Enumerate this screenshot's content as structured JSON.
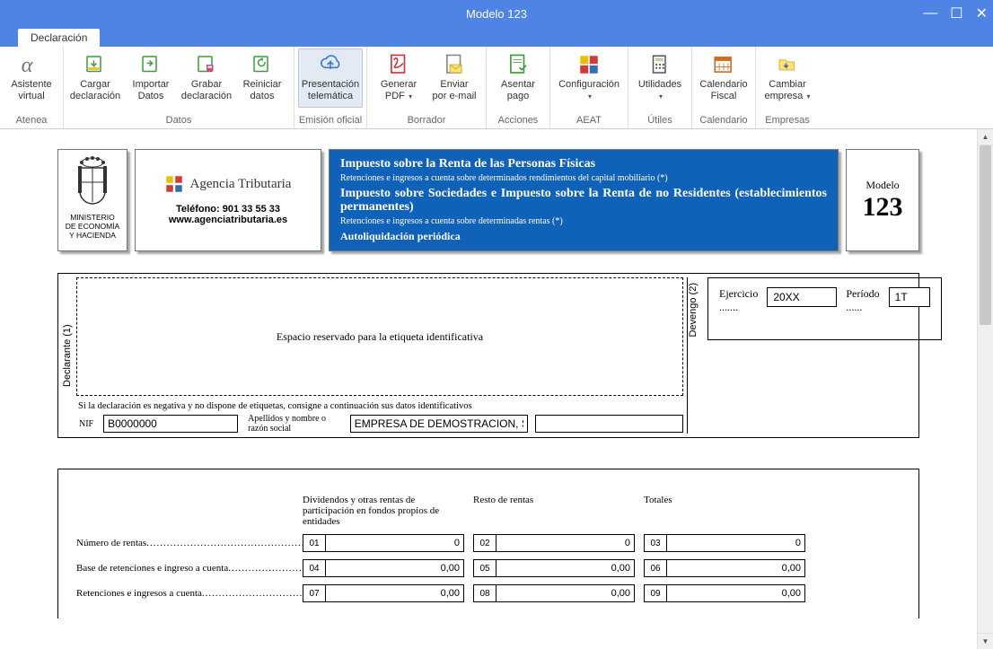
{
  "window": {
    "title": "Modelo 123"
  },
  "tabs": {
    "declaracion": "Declaración"
  },
  "ribbon": {
    "groups": {
      "atenea": {
        "label": "Atenea",
        "asistente": {
          "l1": "Asistente",
          "l2": "virtual"
        }
      },
      "datos": {
        "label": "Datos",
        "cargar": {
          "l1": "Cargar",
          "l2": "declaración"
        },
        "importar": {
          "l1": "Importar",
          "l2": "Datos"
        },
        "grabar": {
          "l1": "Grabar",
          "l2": "declaración"
        },
        "reiniciar": {
          "l1": "Reiniciar",
          "l2": "datos"
        }
      },
      "emision": {
        "label": "Emisión oficial",
        "presentacion": {
          "l1": "Presentación",
          "l2": "telemática"
        }
      },
      "borrador": {
        "label": "Borrador",
        "generar": {
          "l1": "Generar",
          "l2": "PDF"
        },
        "enviar": {
          "l1": "Enviar",
          "l2": "por e-mail"
        }
      },
      "acciones": {
        "label": "Acciones",
        "asentar": {
          "l1": "Asentar",
          "l2": "pago"
        }
      },
      "aeat": {
        "label": "AEAT",
        "config": {
          "l1": "Configuración",
          "l2": ""
        }
      },
      "utiles": {
        "label": "Útiles",
        "utilidades": {
          "l1": "Utilidades",
          "l2": ""
        }
      },
      "calendario": {
        "label": "Calendario",
        "calfiscal": {
          "l1": "Calendario",
          "l2": "Fiscal"
        }
      },
      "empresas": {
        "label": "Empresas",
        "cambiar": {
          "l1": "Cambiar",
          "l2": "empresa"
        }
      }
    }
  },
  "form": {
    "ministry": "MINISTERIO\nDE ECONOMÍA\nY HACIENDA",
    "agency": {
      "title": "Agencia Tributaria",
      "phone": "Teléfono: 901 33 55 33",
      "url": "www.agenciatributaria.es"
    },
    "blue": {
      "l1": "Impuesto sobre la Renta de las Personas Físicas",
      "l2": "Retenciones e ingresos a cuenta sobre determinados rendimientos del capital mobiliario (*)",
      "l3": "Impuesto sobre Sociedades e Impuesto sobre la Renta de no Residentes (establecimientos permanentes)",
      "l4": "Retenciones e ingresos a cuenta sobre determinadas rentas (*)",
      "l5": "Autoliquidación periódica"
    },
    "model": {
      "label": "Modelo",
      "number": "123"
    },
    "declarante_label": "Declarante (1)",
    "devengo_label": "Devengo (2)",
    "etiqueta_text": "Espacio reservado para la etiqueta identificativa",
    "nota_negativa": "Si la declaración es negativa y no dispone de etiquetas, consigne a continuación sus datos identificativos",
    "nif_label": "NIF",
    "nif_value": "B0000000",
    "razon_label": "Apellidos y nombre o razón social",
    "razon_value": "EMPRESA DE DEMOSTRACION, S.L.",
    "ejercicio_label": "Ejercicio .......",
    "ejercicio_value": "20XX",
    "periodo_label": "Período ......",
    "periodo_value": "1T",
    "col_headers": {
      "c1": "Dividendos y otras rentas de participación en fondos propios de entidades",
      "c2": "Resto de rentas",
      "c3": "Totales"
    },
    "rows": {
      "r1": {
        "label": "Número de rentas",
        "c1n": "01",
        "c1v": "0",
        "c2n": "02",
        "c2v": "0",
        "c3n": "03",
        "c3v": "0"
      },
      "r2": {
        "label": "Base de retenciones e ingreso a cuenta",
        "c1n": "04",
        "c1v": "0,00",
        "c2n": "05",
        "c2v": "0,00",
        "c3n": "06",
        "c3v": "0,00"
      },
      "r3": {
        "label": "Retenciones e ingresos a cuenta",
        "c1n": "07",
        "c1v": "0,00",
        "c2n": "08",
        "c2v": "0,00",
        "c3n": "09",
        "c3v": "0,00"
      }
    }
  }
}
